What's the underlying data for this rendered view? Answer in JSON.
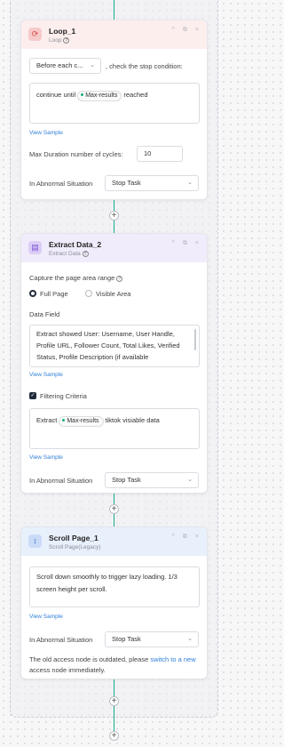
{
  "loop": {
    "title": "Loop_1",
    "subtitle": "Loop",
    "dropdown_value": "Before each c...",
    "condition_label": ", check the stop condition:",
    "cond_prefix": "continue until",
    "cond_tag": "Max-results",
    "cond_suffix": "reached",
    "view_sample": "View Sample",
    "max_label": "Max Duration number of cycles:",
    "max_value": "10",
    "abnormal_label": "In Abnormal Situation",
    "abnormal_value": "Stop Task"
  },
  "extract": {
    "title": "Extract Data_2",
    "subtitle": "Extract Data",
    "capture_label": "Capture the page area range",
    "full_page": "Full Page",
    "visible_area": "Visible Area",
    "data_field_label": "Data Field",
    "data_field_text": "Extract showed User: Username, User Handle, Profile URL, Follower Count, Total Likes, Verified Status, Profile Description (if available",
    "view_sample": "View Sample",
    "filtering_label": "Filtering Criteria",
    "filter_prefix": "Extract",
    "filter_tag": "Max-results",
    "filter_suffix": "tiktok visiable data",
    "view_sample_2": "View Sample",
    "abnormal_label": "In Abnormal Situation",
    "abnormal_value": "Stop Task"
  },
  "scroll": {
    "title": "Scroll Page_1",
    "subtitle": "Scroll Page(Legacy)",
    "text": "Scroll down smoothly to trigger lazy loading. 1/3 screen height per scroll.",
    "view_sample": "View Sample",
    "abnormal_label": "In Abnormal Situation",
    "abnormal_value": "Stop Task",
    "notice_prefix": "The old access node is outdated, please",
    "notice_link": "switch to a new",
    "notice_suffix": "access node immediately."
  },
  "icons": {
    "plus": "+",
    "chevron": "⌄",
    "collapse": "^",
    "copy": "⧉",
    "close": "×",
    "check": "✓",
    "help": "?"
  }
}
